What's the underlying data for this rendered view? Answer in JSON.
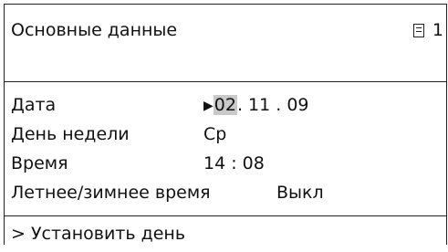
{
  "header": {
    "title": "Основные данные",
    "page_icon": "list-page-icon",
    "page_number": "1"
  },
  "rows": [
    {
      "label": "Дата",
      "cursor_icon": "▶",
      "day": "02",
      "rest": ". 11 . 09"
    },
    {
      "label": "День недели",
      "value": "Ср"
    },
    {
      "label": "Время",
      "value": "14 : 08"
    },
    {
      "label": "Летнее/зимнее время",
      "value": "Выкл"
    }
  ],
  "footer": {
    "hint": "> Установить день"
  },
  "colors": {
    "highlight": "#c9c9c9",
    "border": "#222222",
    "text": "#111111"
  }
}
